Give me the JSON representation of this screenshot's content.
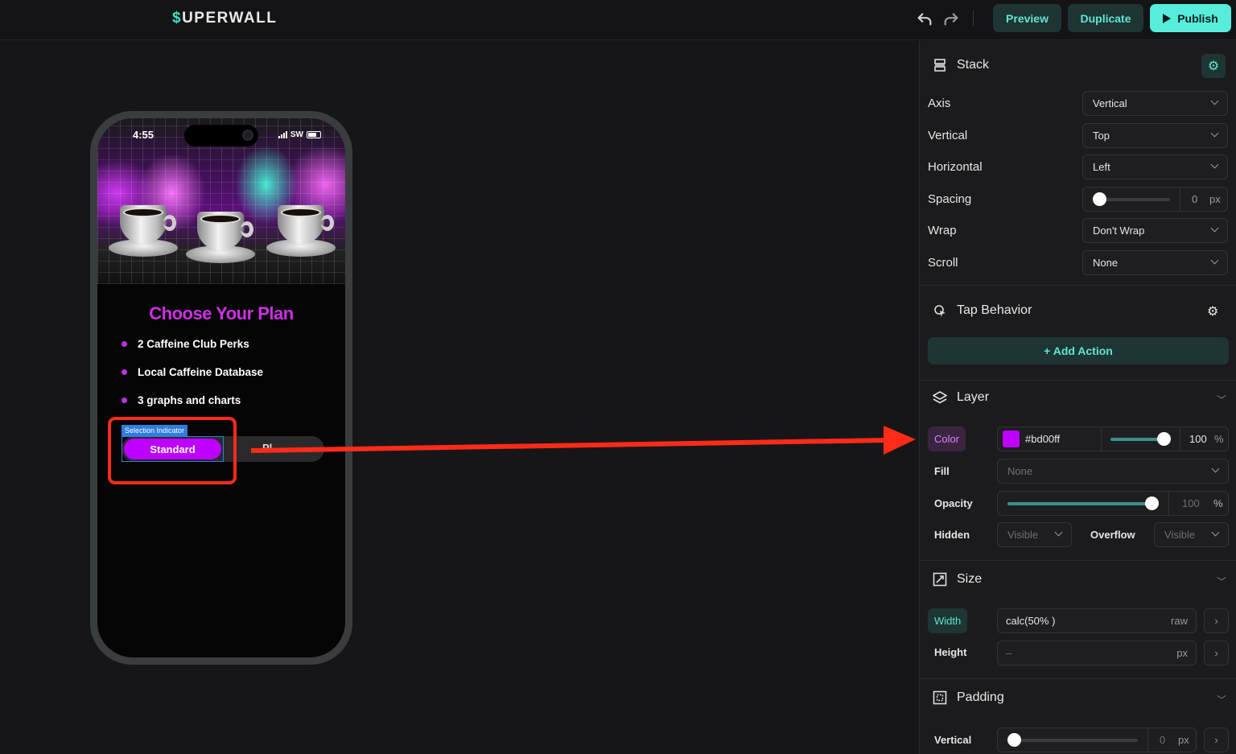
{
  "app": {
    "logo_accent": "$",
    "logo_text": "UPERWALL"
  },
  "toolbar": {
    "undo_icon": "undo-icon",
    "redo_icon": "redo-icon",
    "preview_label": "Preview",
    "duplicate_label": "Duplicate",
    "publish_label": "Publish",
    "accent_color": "#56eedb"
  },
  "phone": {
    "time": "4:55",
    "carrier": "SW",
    "title": "Choose Your Plan",
    "perks": [
      "2 Caffeine Club Perks",
      "Local Caffeine Database",
      "3 graphs and charts"
    ],
    "selection_tag": "Selection Indicator",
    "selected_plan": "Standard",
    "second_plan": "Pl...",
    "title_color": "#d02fe8",
    "button_color": "#bd00ff"
  },
  "stack": {
    "title": "Stack",
    "axis_label": "Axis",
    "axis_value": "Vertical",
    "vertical_label": "Vertical",
    "vertical_value": "Top",
    "horizontal_label": "Horizontal",
    "horizontal_value": "Left",
    "spacing_label": "Spacing",
    "spacing_value": "0",
    "spacing_unit": "px",
    "wrap_label": "Wrap",
    "wrap_value": "Don't Wrap",
    "scroll_label": "Scroll",
    "scroll_value": "None"
  },
  "tap_behavior": {
    "title": "Tap Behavior",
    "add_action_label": "+ Add Action"
  },
  "layer": {
    "title": "Layer",
    "color_label": "Color",
    "color_value": "#bd00ff",
    "color_opacity": "100",
    "color_opacity_unit": "%",
    "color_slider_fraction": 1.0,
    "fill_label": "Fill",
    "fill_value": "None",
    "opacity_label": "Opacity",
    "opacity_value": "100",
    "opacity_unit": "%",
    "hidden_label": "Hidden",
    "hidden_value": "Visible",
    "overflow_label": "Overflow",
    "overflow_value": "Visible"
  },
  "size": {
    "title": "Size",
    "width_label": "Width",
    "width_value": "calc(50% )",
    "width_unit": "raw",
    "height_label": "Height",
    "height_value": "–",
    "height_unit": "px"
  },
  "padding": {
    "title": "Padding",
    "vertical_label": "Vertical",
    "vertical_value": "0",
    "vertical_unit": "px"
  }
}
